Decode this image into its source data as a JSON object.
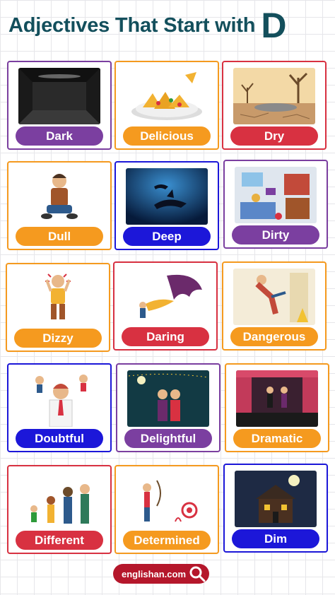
{
  "header": {
    "title": "Adjectives That Start with",
    "letter": "D"
  },
  "colors": {
    "purple": "#7b3fa0",
    "orange": "#f59a1f",
    "red": "#d83141",
    "blue": "#1c17d9",
    "title": "#134f5c"
  },
  "cards": [
    {
      "word": "Dark",
      "color": "#7b3fa0",
      "icon": "dark-room-image"
    },
    {
      "word": "Delicious",
      "color": "#f59a1f",
      "icon": "nachos-image"
    },
    {
      "word": "Dry",
      "color": "#d83141",
      "icon": "dry-land-image"
    },
    {
      "word": "Dull",
      "color": "#f59a1f",
      "icon": "dull-boy-image"
    },
    {
      "word": "Deep",
      "color": "#1c17d9",
      "icon": "deep-sea-image"
    },
    {
      "word": "Dirty",
      "color": "#7b3fa0",
      "icon": "dirty-room-image"
    },
    {
      "word": "Dizzy",
      "color": "#f59a1f",
      "icon": "dizzy-man-image"
    },
    {
      "word": "Daring",
      "color": "#d83141",
      "icon": "daring-dragon-image"
    },
    {
      "word": "Dangerous",
      "color": "#f59a1f",
      "icon": "slipping-woman-image"
    },
    {
      "word": "Doubtful",
      "color": "#1c17d9",
      "icon": "doubtful-man-image"
    },
    {
      "word": "Delightful",
      "color": "#7b3fa0",
      "icon": "couple-night-image"
    },
    {
      "word": "Dramatic",
      "color": "#f59a1f",
      "icon": "theater-stage-image"
    },
    {
      "word": "Different",
      "color": "#d83141",
      "icon": "different-people-image"
    },
    {
      "word": "Determined",
      "color": "#f59a1f",
      "icon": "archer-image"
    },
    {
      "word": "Dim",
      "color": "#1c17d9",
      "icon": "dim-house-image"
    }
  ],
  "footer": {
    "site": "englishan.com",
    "icon": "search-icon"
  }
}
